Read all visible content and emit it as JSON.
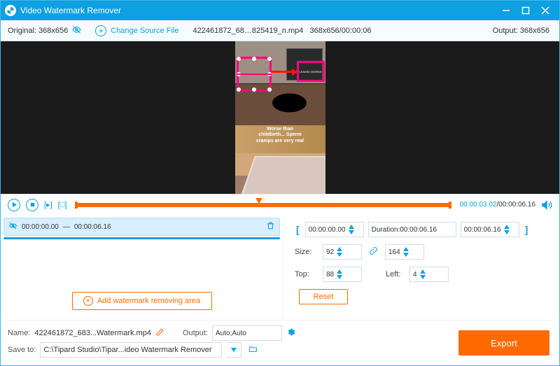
{
  "titlebar": {
    "title": "Video Watermark Remover"
  },
  "toolbar": {
    "original_label": "Original:",
    "original_dim": "368x656",
    "change_source": "Change Source File",
    "filename": "422461872_68…825419_n.mp4",
    "source_meta": "368x656/00:00:06",
    "output_label": "Output:",
    "output_dim": "368x656"
  },
  "preview": {
    "caption_l1": "Worse than",
    "caption_l2": "childbirth... Sperm",
    "caption_l3": "cramps are very real",
    "result_text": "LEAKED WORDS"
  },
  "controls": {
    "current": "00:00:03.02",
    "total": "00:00:06.16"
  },
  "segment": {
    "start": "00:00:00.00",
    "dash": "—",
    "end": "00:00:06.16"
  },
  "add_button": "Add watermark removing area",
  "range": {
    "in": "00:00:00.00",
    "duration_label": "Duration:",
    "duration": "00:00:06.16",
    "out": "00:00:06.16"
  },
  "size": {
    "label": "Size:",
    "w": "92",
    "h": "164"
  },
  "pos": {
    "top_label": "Top:",
    "top": "88",
    "left_label": "Left:",
    "left": "4"
  },
  "reset": "Reset",
  "bottom": {
    "name_label": "Name:",
    "name": "422461872_683...Watermark.mp4",
    "output_label": "Output:",
    "output": "Auto;Auto",
    "saveto_label": "Save to:",
    "path": "C:\\Tipard Studio\\Tipar...ideo Watermark Remover"
  },
  "export": "Export"
}
